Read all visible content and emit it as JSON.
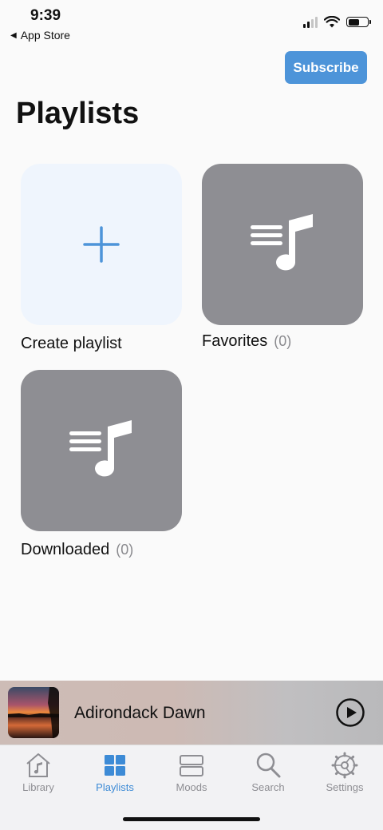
{
  "status": {
    "time": "9:39",
    "back_app": "App Store",
    "signal_icon": "cellular-signal-icon",
    "wifi_icon": "wifi-icon",
    "battery_icon": "battery-icon"
  },
  "header": {
    "subscribe_label": "Subscribe",
    "title": "Playlists"
  },
  "playlists": [
    {
      "label": "Create playlist",
      "count": "",
      "icon": "plus-icon"
    },
    {
      "label": "Favorites",
      "count": "(0)",
      "icon": "music-list-icon"
    },
    {
      "label": "Downloaded",
      "count": "(0)",
      "icon": "music-list-icon"
    }
  ],
  "now_playing": {
    "title": "Adirondack Dawn",
    "play_icon": "play-circle-icon"
  },
  "tabs": [
    {
      "label": "Library",
      "icon": "library-house-icon",
      "active": false
    },
    {
      "label": "Playlists",
      "icon": "grid-icon",
      "active": true
    },
    {
      "label": "Moods",
      "icon": "moods-icon",
      "active": false
    },
    {
      "label": "Search",
      "icon": "search-icon",
      "active": false
    },
    {
      "label": "Settings",
      "icon": "gear-icon",
      "active": false
    }
  ],
  "colors": {
    "accent": "#4d94d9",
    "active_tab": "#3d8bd6",
    "tile_gray": "#8e8e93",
    "create_tile": "#eff5fd"
  }
}
